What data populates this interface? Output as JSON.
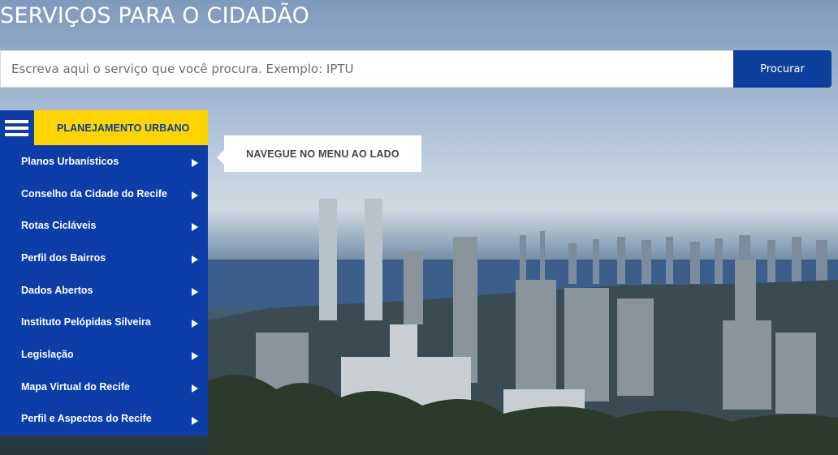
{
  "header": {
    "title": "SERVIÇOS PARA O CIDADÃO"
  },
  "search": {
    "placeholder": "Escreva aqui o serviço que você procura. Exemplo: IPTU",
    "value": "",
    "button_label": "Procurar"
  },
  "menu": {
    "toggle_icon": "hamburger-menu-icon",
    "title": "PLANEJAMENTO URBANO",
    "items": [
      {
        "label": "Planos Urbanísticos"
      },
      {
        "label": "Conselho da Cidade do Recife"
      },
      {
        "label": "Rotas Cicláveis"
      },
      {
        "label": "Perfil dos Bairros"
      },
      {
        "label": "Dados Abertos"
      },
      {
        "label": "Instituto Pelópidas Silveira"
      },
      {
        "label": "Legislação"
      },
      {
        "label": "Mapa Virtual do Recife"
      },
      {
        "label": "Perfil e Aspectos do Recife"
      }
    ],
    "item_icon": "triangle-right-icon"
  },
  "tooltip": {
    "text": "NAVEGUE NO MENU AO LADO"
  },
  "colors": {
    "menu_blue": "#0c3da8",
    "header_yellow": "#ffd400",
    "button_blue": "#0f3f9c"
  }
}
